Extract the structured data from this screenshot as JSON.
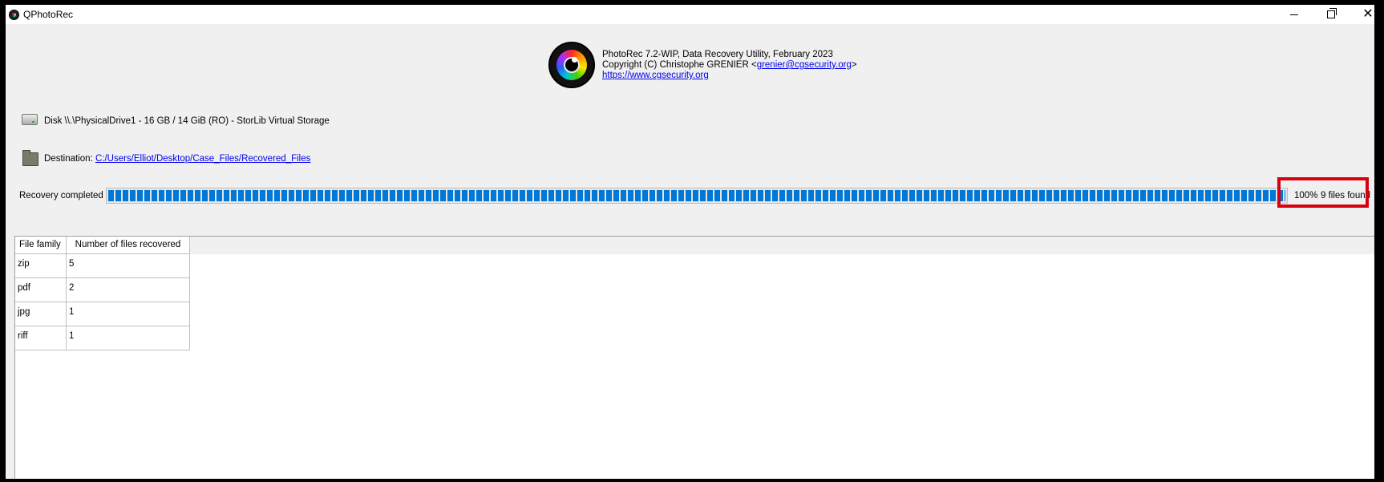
{
  "window": {
    "title": "QPhotoRec"
  },
  "header": {
    "line1": "PhotoRec 7.2-WIP, Data Recovery Utility, February 2023",
    "copyright_prefix": "Copyright (C) Christophe GRENIER <",
    "email": "grenier@cgsecurity.org",
    "copyright_suffix": ">",
    "website": "https://www.cgsecurity.org"
  },
  "disk": {
    "label": "Disk \\\\.\\PhysicalDrive1 - 16 GB / 14 GiB (RO) - StorLib Virtual Storage"
  },
  "destination": {
    "label": "Destination:",
    "path": "C:/Users/Elliot/Desktop/Case_Files/Recovered_Files"
  },
  "progress": {
    "status": "Recovery completed",
    "percent_text": "100%",
    "percent_value": 100,
    "files_found": "9 files found"
  },
  "table": {
    "headers": [
      "File family",
      "Number of files recovered"
    ],
    "rows": [
      {
        "family": "zip",
        "count": "5"
      },
      {
        "family": "pdf",
        "count": "2"
      },
      {
        "family": "jpg",
        "count": "1"
      },
      {
        "family": "riff",
        "count": "1"
      }
    ]
  },
  "colors": {
    "progress_fill": "#0078d7",
    "highlight": "#d8000f",
    "link": "#0000ee"
  },
  "icons": [
    "app-icon",
    "minimize-icon",
    "maximize-icon",
    "close-icon",
    "photorec-logo",
    "disk-icon",
    "folder-icon"
  ]
}
